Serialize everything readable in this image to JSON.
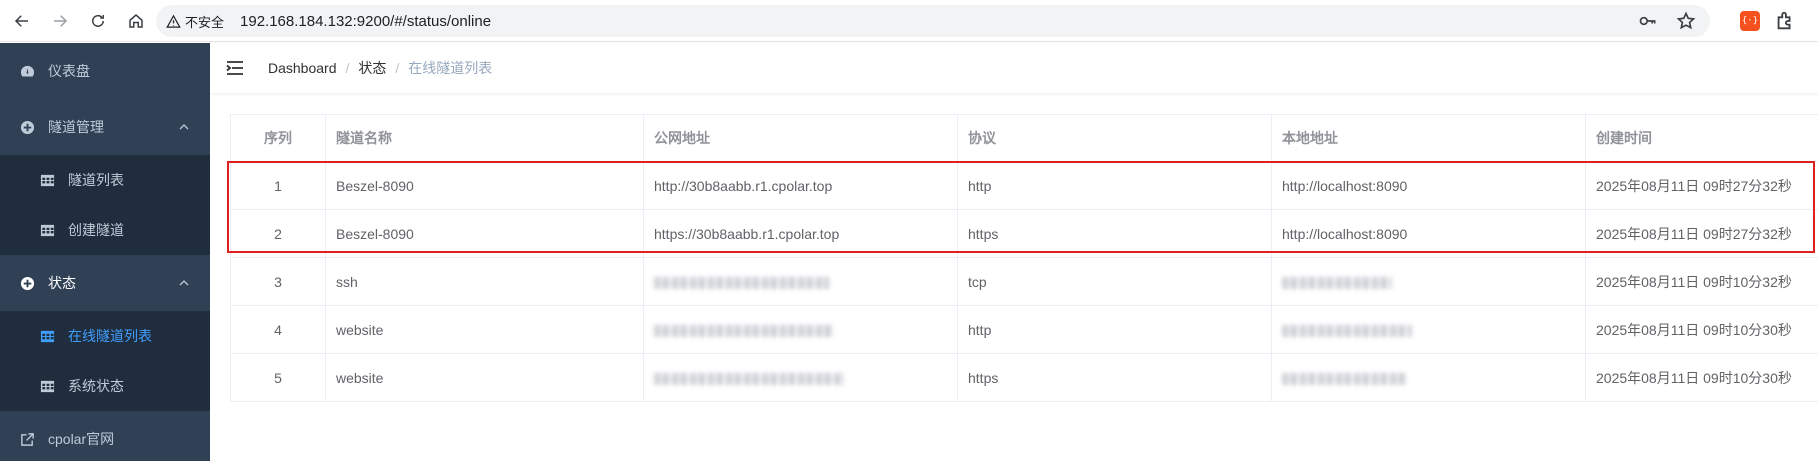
{
  "browser": {
    "security_label": "不安全",
    "url": "192.168.184.132:9200/#/status/online",
    "ext_label": "{·}"
  },
  "sidebar": {
    "items": [
      {
        "label": "仪表盘",
        "icon": "dashboard-icon"
      },
      {
        "label": "隧道管理",
        "icon": "plus-circle-icon",
        "expanded": true,
        "children": [
          {
            "label": "隧道列表",
            "icon": "table-icon"
          },
          {
            "label": "创建隧道",
            "icon": "table-icon"
          }
        ]
      },
      {
        "label": "状态",
        "icon": "plus-circle-icon",
        "expanded": true,
        "children": [
          {
            "label": "在线隧道列表",
            "icon": "table-icon",
            "active": true
          },
          {
            "label": "系统状态",
            "icon": "table-icon"
          }
        ]
      },
      {
        "label": "cpolar官网",
        "icon": "external-link-icon"
      }
    ]
  },
  "breadcrumb": [
    "Dashboard",
    "状态",
    "在线隧道列表"
  ],
  "table": {
    "headers": [
      "序列",
      "隧道名称",
      "公网地址",
      "协议",
      "本地地址",
      "创建时间"
    ],
    "rows": [
      {
        "no": "1",
        "name": "Beszel-8090",
        "public": "http://30b8aabb.r1.cpolar.top",
        "proto": "http",
        "local": "http://localhost:8090",
        "time": "2025年08月11日 09时27分32秒"
      },
      {
        "no": "2",
        "name": "Beszel-8090",
        "public": "https://30b8aabb.r1.cpolar.top",
        "proto": "https",
        "local": "http://localhost:8090",
        "time": "2025年08月11日 09时27分32秒"
      },
      {
        "no": "3",
        "name": "ssh",
        "public": "",
        "proto": "tcp",
        "local": "",
        "time": "2025年08月11日 09时10分32秒"
      },
      {
        "no": "4",
        "name": "website",
        "public": "",
        "proto": "http",
        "local": "",
        "time": "2025年08月11日 09时10分30秒"
      },
      {
        "no": "5",
        "name": "website",
        "public": "",
        "proto": "https",
        "local": "",
        "time": "2025年08月11日 09时10分30秒"
      }
    ]
  },
  "colors": {
    "sidebar_bg": "#304156",
    "submenu_bg": "#1f2d3d",
    "active": "#409eff",
    "highlight": "#e02020"
  }
}
